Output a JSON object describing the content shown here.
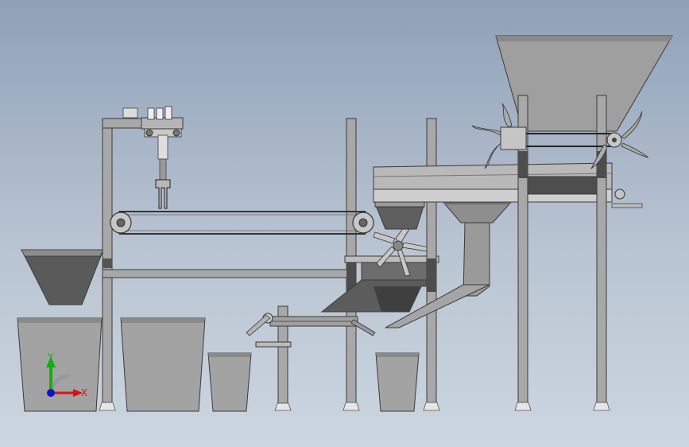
{
  "viewport": {
    "background_top": "#8fa1b8",
    "background_bottom": "#ccd6e1"
  },
  "colors": {
    "frame": "#a6a6a6",
    "frame_dark": "#4d4d4d",
    "hopper": "#9a9a9a",
    "hopper_dark": "#5a5a5a",
    "bin": "#a0a0a0",
    "axis_x": "#e01010",
    "axis_y": "#10b010",
    "axis_z": "#1010d0"
  },
  "triad": {
    "x_label": "X",
    "y_label": "Y"
  }
}
